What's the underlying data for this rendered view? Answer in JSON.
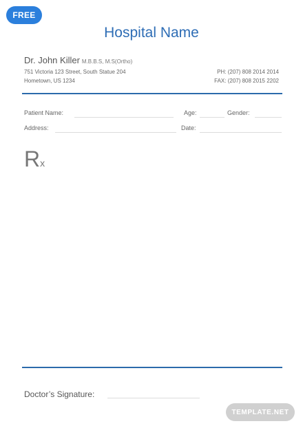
{
  "badge": {
    "label": "FREE"
  },
  "header": {
    "hospital_name": "Hospital Name",
    "doctor_name": "Dr. John Killer",
    "credentials": "M.B.B.S, M.S(Ortho)",
    "address_line1": "751 Victoria 123 Street, South Statue 204",
    "address_line2": "Hometown, US 1234",
    "phone": "PH: (207) 808 2014 2014",
    "fax": "FAX: (207) 808 2015 2202"
  },
  "patient_form": {
    "patient_name_label": "Patient Name:",
    "age_label": "Age:",
    "gender_label": "Gender:",
    "address_label": "Address:",
    "date_label": "Date:"
  },
  "rx": {
    "main": "R",
    "sub": "x"
  },
  "footer": {
    "signature_label": "Doctor’s Signature:"
  },
  "watermark": {
    "label": "TEMPLATE.NET"
  },
  "colors": {
    "accent": "#2e6db5",
    "badge": "#2b7fdc",
    "rule": "#2b6aab"
  }
}
